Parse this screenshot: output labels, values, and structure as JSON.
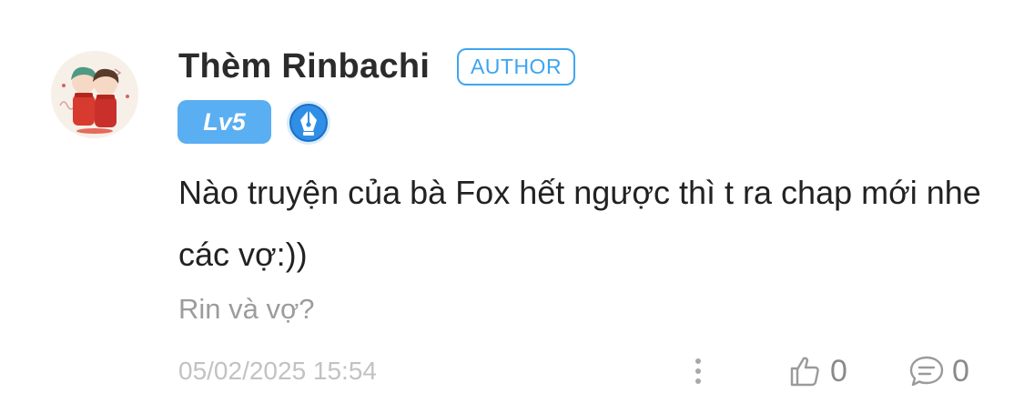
{
  "comment": {
    "username": "Thèm Rinbachi",
    "author_badge": "AUTHOR",
    "level": "Lv5",
    "text": "Nào truyện của bà Fox hết ngược thì t ra chap mới nhe các vợ:))",
    "reply_hint": "Rin và vợ?",
    "timestamp": "05/02/2025 15:54",
    "like_count": "0",
    "reply_count": "0"
  },
  "icons": {
    "avatar": "avatar-illustration-two-characters",
    "pen_badge": "fountain-pen-icon",
    "more": "more-vertical-icon",
    "like": "thumbs-up-icon",
    "reply": "chat-bubble-icon"
  },
  "colors": {
    "accent": "#3da5f0",
    "level_badge_bg": "#5aaef2",
    "username": "#2b2b2b",
    "secondary_text": "#9c9c9c",
    "timestamp": "#c2c2c2"
  }
}
